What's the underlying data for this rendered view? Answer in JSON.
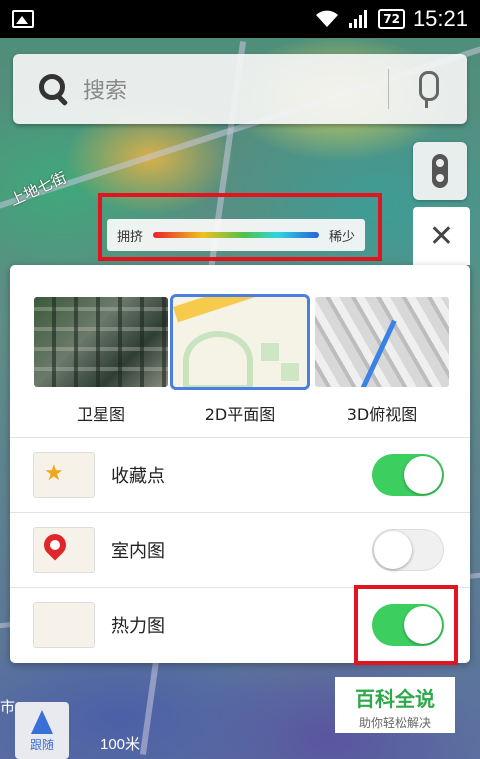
{
  "status_bar": {
    "battery": "72",
    "time": "15:21"
  },
  "map": {
    "street_label": "上地七街",
    "scale_label": "100米",
    "partial_label": "市"
  },
  "search": {
    "placeholder": "搜索"
  },
  "legend": {
    "congested_label": "拥挤",
    "sparse_label": "稀少"
  },
  "panel": {
    "close_icon": "close-icon",
    "map_types": [
      {
        "label": "卫星图",
        "selected": false
      },
      {
        "label": "2D平面图",
        "selected": true
      },
      {
        "label": "3D俯视图",
        "selected": false
      }
    ],
    "layers": [
      {
        "label": "收藏点",
        "enabled": true,
        "icon": "star-icon"
      },
      {
        "label": "室内图",
        "enabled": false,
        "icon": "pin-icon"
      },
      {
        "label": "热力图",
        "enabled": true,
        "icon": "heatmap-icon"
      }
    ]
  },
  "compass": {
    "label": "跟随"
  },
  "watermark": {
    "title": "百科全说",
    "subtitle": "助你轻松解决"
  },
  "colors": {
    "toggle_on": "#3ccf60",
    "highlight": "#e0151f",
    "selected_border": "#4a7fe0"
  }
}
